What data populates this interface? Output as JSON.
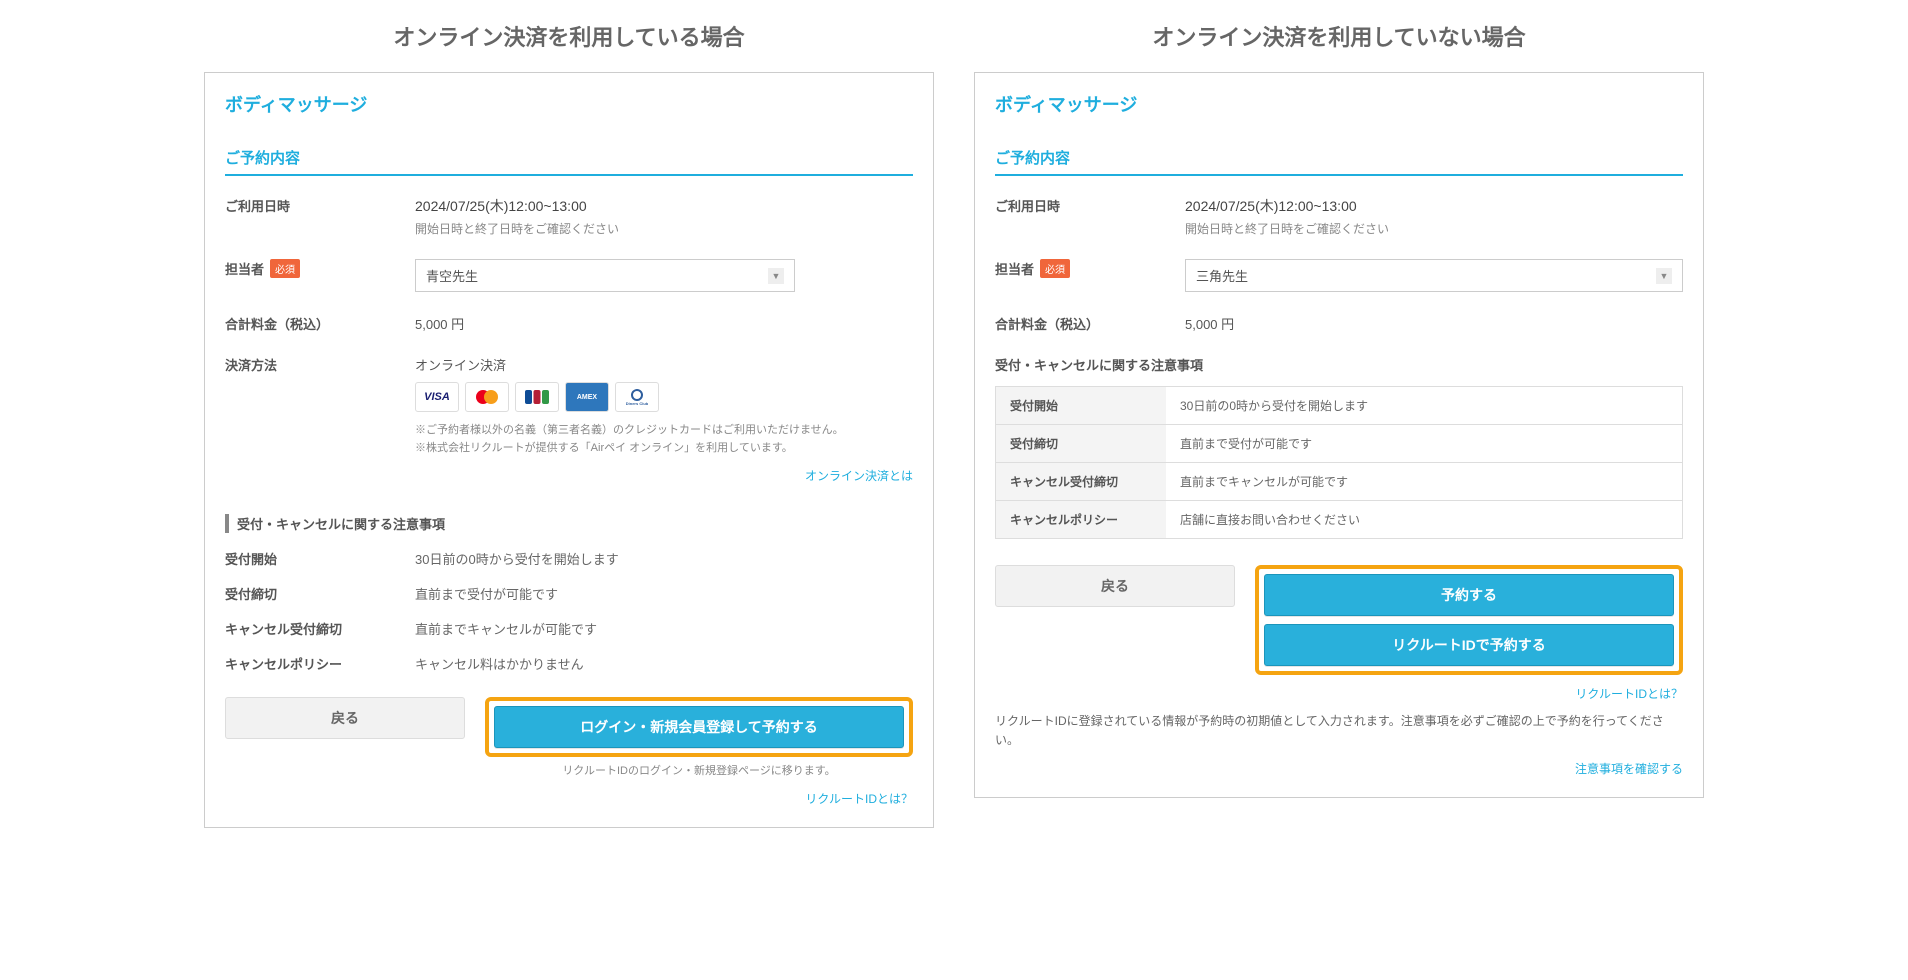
{
  "left": {
    "heading": "オンライン決済を利用している場合",
    "service_name": "ボディマッサージ",
    "section_title": "ご予約内容",
    "fields": {
      "datetime_label": "ご利用日時",
      "datetime_value": "2024/07/25(木)12:00~13:00",
      "datetime_sub": "開始日時と終了日時をご確認ください",
      "staff_label": "担当者",
      "staff_required": "必須",
      "staff_value": "青空先生",
      "total_label": "合計料金（税込）",
      "total_value": "5,000 円",
      "payment_label": "決済方法",
      "payment_value": "オンライン決済"
    },
    "card_logos": [
      "VISA",
      "Mastercard",
      "JCB",
      "AMEX",
      "Diners"
    ],
    "payment_note1": "※ご予約者様以外の名義（第三者名義）のクレジットカードはご利用いただけません。",
    "payment_note2": "※株式会社リクルートが提供する「Airペイ オンライン」を利用しています。",
    "payment_link": "オンライン決済とは",
    "notice_header": "受付・キャンセルに関する注意事項",
    "notice_rows": [
      {
        "label": "受付開始",
        "value": "30日前の0時から受付を開始します"
      },
      {
        "label": "受付締切",
        "value": "直前まで受付が可能です"
      },
      {
        "label": "キャンセル受付締切",
        "value": "直前までキャンセルが可能です"
      },
      {
        "label": "キャンセルポリシー",
        "value": "キャンセル料はかかりません"
      }
    ],
    "back_btn": "戻る",
    "submit_btn": "ログイン・新規会員登録して予約する",
    "submit_note": "リクルートIDのログイン・新規登録ページに移ります。",
    "bottom_link": "リクルートIDとは？"
  },
  "right": {
    "heading": "オンライン決済を利用していない場合",
    "service_name": "ボディマッサージ",
    "section_title": "ご予約内容",
    "fields": {
      "datetime_label": "ご利用日時",
      "datetime_value": "2024/07/25(木)12:00~13:00",
      "datetime_sub": "開始日時と終了日時をご確認ください",
      "staff_label": "担当者",
      "staff_required": "必須",
      "staff_value": "三角先生",
      "total_label": "合計料金（税込）",
      "total_value": "5,000 円"
    },
    "notice_header": "受付・キャンセルに関する注意事項",
    "notice_rows": [
      {
        "label": "受付開始",
        "value": "30日前の0時から受付を開始します"
      },
      {
        "label": "受付締切",
        "value": "直前まで受付が可能です"
      },
      {
        "label": "キャンセル受付締切",
        "value": "直前までキャンセルが可能です"
      },
      {
        "label": "キャンセルポリシー",
        "value": "店舗に直接お問い合わせください"
      }
    ],
    "back_btn": "戻る",
    "submit_btn1": "予約する",
    "submit_btn2": "リクルートIDで予約する",
    "link1": "リクルートIDとは？",
    "note": "リクルートIDに登録されている情報が予約時の初期値として入力されます。注意事項を必ずご確認の上で予約を行ってください。",
    "link2": "注意事項を確認する"
  }
}
